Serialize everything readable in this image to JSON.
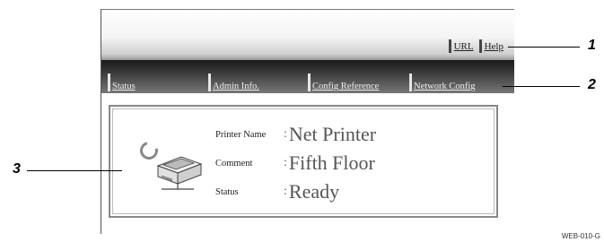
{
  "header": {
    "links": [
      {
        "label": "URL"
      },
      {
        "label": "Help"
      }
    ]
  },
  "nav": {
    "tabs": [
      {
        "label": "Status"
      },
      {
        "label": "Admin Info."
      },
      {
        "label": "Config Reference"
      },
      {
        "label": "Network Config"
      }
    ]
  },
  "panel": {
    "printer_name_label": "Printer Name",
    "printer_name_value": "Net Printer",
    "comment_label": "Comment",
    "comment_value": "Fifth Floor",
    "status_label": "Status",
    "status_value": "Ready",
    "separator": ":"
  },
  "callouts": {
    "one": "1",
    "two": "2",
    "three": "3"
  },
  "figure_code": "WEB-010-G",
  "icons": {
    "spinner": "refresh-icon",
    "printer": "printer-icon"
  }
}
